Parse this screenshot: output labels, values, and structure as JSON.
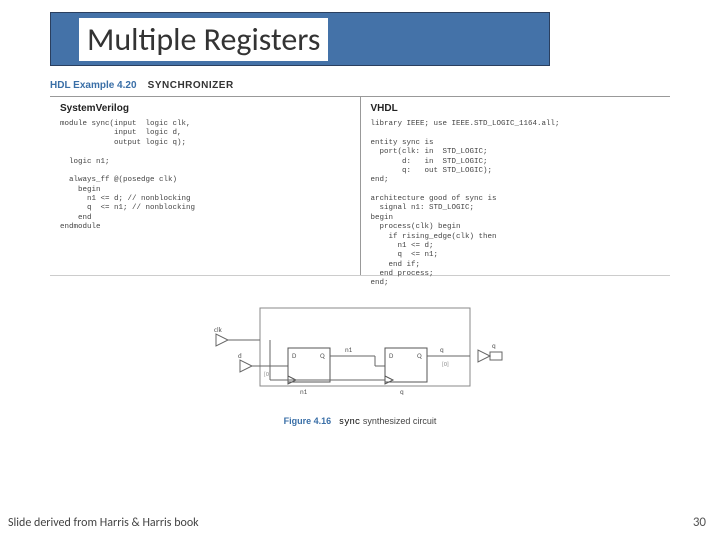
{
  "title": "Multiple Registers",
  "example": {
    "label": "HDL Example 4.20",
    "name": "SYNCHRONIZER"
  },
  "left": {
    "lang": "SystemVerilog",
    "code": "module sync(input  logic clk,\n            input  logic d,\n            output logic q);\n\n  logic n1;\n\n  always_ff @(posedge clk)\n    begin\n      n1 <= d; // nonblocking\n      q  <= n1; // nonblocking\n    end\nendmodule"
  },
  "right": {
    "lang": "VHDL",
    "code": "library IEEE; use IEEE.STD_LOGIC_1164.all;\n\nentity sync is\n  port(clk: in  STD_LOGIC;\n       d:   in  STD_LOGIC;\n       q:   out STD_LOGIC);\nend;\n\narchitecture good of sync is\n  signal n1: STD_LOGIC;\nbegin\n  process(clk) begin\n    if rising_edge(clk) then\n      n1 <= d;\n      q  <= n1;\n    end if;\n  end process;\nend;"
  },
  "circuit": {
    "clk": "clk",
    "d_port": "d",
    "q_port": "q",
    "D": "D",
    "Q": "Q",
    "n1_inst": "n1",
    "q_inst": "q",
    "net_n1": "n1",
    "net_q": "q",
    "d_idx": "[0]",
    "q_idx": "[0]"
  },
  "figure": {
    "label": "Figure 4.16",
    "mono": "sync",
    "rest": " synthesized circuit"
  },
  "footer": {
    "left": "Slide derived from Harris & Harris book",
    "right": "30"
  }
}
